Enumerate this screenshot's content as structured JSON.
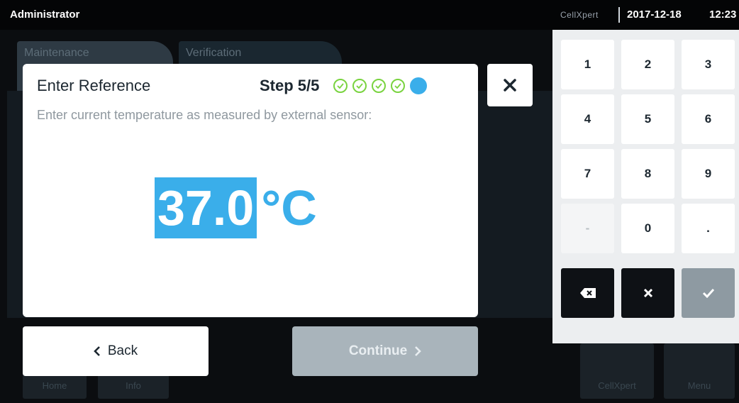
{
  "status": {
    "user": "Administrator",
    "brand": "CellXpert",
    "date": "2017-12-18",
    "time": "12:23"
  },
  "background": {
    "tab_maintenance": "Maintenance",
    "tab_verification": "Verification",
    "bottom_left_1": "Home",
    "bottom_left_2": "Info",
    "bottom_right_1": "CellXpert",
    "bottom_right_2": "Menu"
  },
  "dialog": {
    "title": "Enter Reference",
    "step_text": "Step 5/5",
    "steps_total": 5,
    "steps_completed": 4,
    "instruction": "Enter current temperature as measured by external sensor:",
    "value": "37.0",
    "unit": "°C"
  },
  "buttons": {
    "back": "Back",
    "continue": "Continue",
    "close_icon": "close-icon"
  },
  "keypad": {
    "keys": [
      {
        "label": "1",
        "state": "enabled"
      },
      {
        "label": "2",
        "state": "enabled"
      },
      {
        "label": "3",
        "state": "enabled"
      },
      {
        "label": "4",
        "state": "enabled"
      },
      {
        "label": "5",
        "state": "enabled"
      },
      {
        "label": "6",
        "state": "enabled"
      },
      {
        "label": "7",
        "state": "enabled"
      },
      {
        "label": "8",
        "state": "enabled"
      },
      {
        "label": "9",
        "state": "enabled"
      },
      {
        "label": "-",
        "state": "disabled"
      },
      {
        "label": "0",
        "state": "enabled"
      },
      {
        "label": ".",
        "state": "enabled"
      }
    ],
    "action_icons": [
      "backspace-icon",
      "clear-icon",
      "confirm-icon"
    ]
  },
  "colors": {
    "accent": "#3aaeea",
    "step_done": "#79d33f",
    "continue_disabled": "#a9b4bb",
    "dark_key": "#0e1115"
  }
}
